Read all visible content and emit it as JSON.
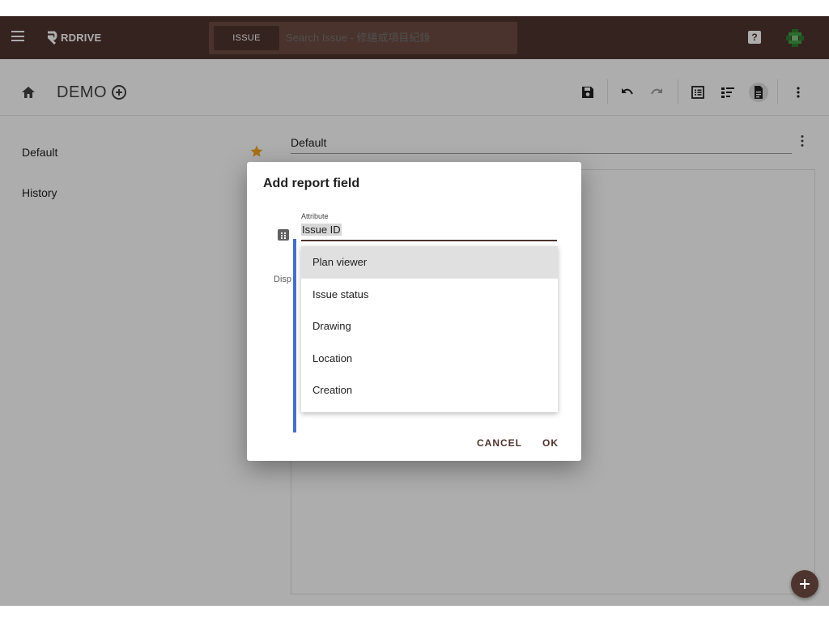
{
  "app": {
    "logo_text": "RDRIVE"
  },
  "search": {
    "scope_label": "ISSUE",
    "placeholder": "Search Issue - 修繕或項目紀錄"
  },
  "topbar": {
    "help_glyph": "?"
  },
  "toolbar": {
    "project_title": "DEMO",
    "icons": [
      "save-icon",
      "undo-icon",
      "redo-icon",
      "list-view-icon",
      "outline-view-icon",
      "document-icon",
      "more-vert-icon"
    ]
  },
  "sidebar": {
    "items": [
      {
        "label": "Default",
        "starred": true
      },
      {
        "label": "History"
      }
    ]
  },
  "main": {
    "report_name": "Default"
  },
  "dialog": {
    "title": "Add report field",
    "attribute_label": "Attribute",
    "attribute_value": "Issue ID",
    "display_label": "Disp",
    "options": [
      {
        "label": "Plan viewer",
        "highlighted": true
      },
      {
        "label": "Issue status"
      },
      {
        "label": "Drawing"
      },
      {
        "label": "Location"
      },
      {
        "label": "Creation"
      }
    ],
    "cancel_label": "CANCEL",
    "ok_label": "OK"
  },
  "colors": {
    "brand": "#4e342e",
    "search_bg": "#6d4c41",
    "star": "#f5a623",
    "selection_bar": "#4472c4"
  }
}
